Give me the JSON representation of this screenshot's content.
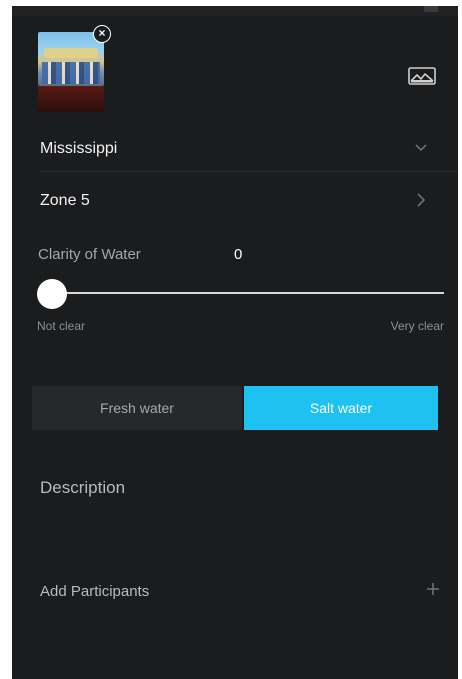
{
  "attachment": {
    "thumbnail_icon": "photo-thumbnail",
    "remove_icon": "close-icon",
    "remove_glyph": "×"
  },
  "gallery": {
    "icon": "image-gallery-icon"
  },
  "state_select": {
    "value": "Mississippi",
    "icon": "chevron-down-icon"
  },
  "zone_select": {
    "value": "Zone 5",
    "icon": "chevron-right-icon"
  },
  "clarity": {
    "label": "Clarity of Water",
    "value": "0",
    "level": 0,
    "min_label": "Not clear",
    "max_label": "Very clear"
  },
  "water_type": {
    "options": [
      "Fresh water",
      "Salt water"
    ],
    "selected": "Salt water"
  },
  "description": {
    "placeholder": "Description"
  },
  "participants": {
    "label": "Add Participants",
    "icon": "plus-icon"
  },
  "colors": {
    "background": "#1b1c1e",
    "accent": "#1ec2f0",
    "text": "#f2f2f2",
    "muted": "#a6a7aa"
  }
}
